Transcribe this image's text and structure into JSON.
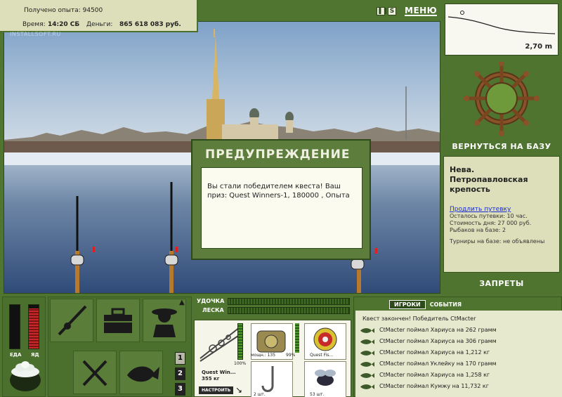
{
  "info": {
    "xp_label": "Получено опыта:",
    "xp_value": "94500",
    "time_label": "Время:",
    "time_value": "14:20 СБ",
    "money_label": "Деньги:",
    "money_value": "865 618 083 руб.",
    "watermark": "INSTALLSOFT.RU"
  },
  "toolbar": {
    "pause_icon": "pause-icon",
    "sound_label": "S",
    "menu_label": "МЕНЮ"
  },
  "depth": {
    "value": "2,70 m"
  },
  "base": {
    "back_label": "ВЕРНУТЬСЯ НА БАЗУ"
  },
  "location": {
    "title": "Нева. Петропавловская крепость",
    "extend_link": "Продлить путевку",
    "remaining": "Осталось путевки: 10 час.",
    "day_cost": "Стоимость дня: 27 000 руб.",
    "fishers": "Рыбаков на базе: 2",
    "tournaments": "Турниры на базе: не объявлены"
  },
  "bans_label": "ЗАПРЕТЫ",
  "dialog": {
    "title": "ПРЕДУПРЕЖДЕНИЕ",
    "message": "Вы стали победителем квеста! Ваш приз: Quest Winners-1, 180000 , Опыта"
  },
  "gauges": {
    "food_label": "ЕДА",
    "poison_label": "ЯД",
    "food_level": 0.0,
    "poison_level": 0.92
  },
  "pages": [
    "1",
    "2",
    "3"
  ],
  "tackle": {
    "rod_label": "УДОЧКА",
    "line_label": "ЛЕСКА"
  },
  "inventory": {
    "rod_name": "Quest Win...",
    "rod_weight": "355 кг",
    "rod_condition": "100%",
    "setup_button": "НАСТРОИТЬ",
    "reel_caption": "мощн.: 135",
    "reel_pct": "99%",
    "line_caption": "Quest Fis...",
    "hook_caption": "2 шт.",
    "bait_caption": "53 шт."
  },
  "events": {
    "tab_players": "ИГРОКИ",
    "tab_events": "СОБЫТИЯ",
    "header": "Квест закончен! Победитель CtMacter",
    "rows": [
      "CtMacter поймал Хариуса на 262 грамм",
      "CtMacter поймал Хариуса на 306 грамм",
      "CtMacter поймал Хариуса на 1,212 кг",
      "CtMacter поймал Уклейку на 170 грамм",
      "CtMacter поймал Хариуса на 1,258 кг",
      "CtMacter поймал Кумжу на 11,732 кг"
    ]
  },
  "colors": {
    "panel_green": "#4e7430",
    "panel_beige": "#dcdfb9",
    "link_blue": "#1a2ad0",
    "poison_red": "#c8282a"
  }
}
